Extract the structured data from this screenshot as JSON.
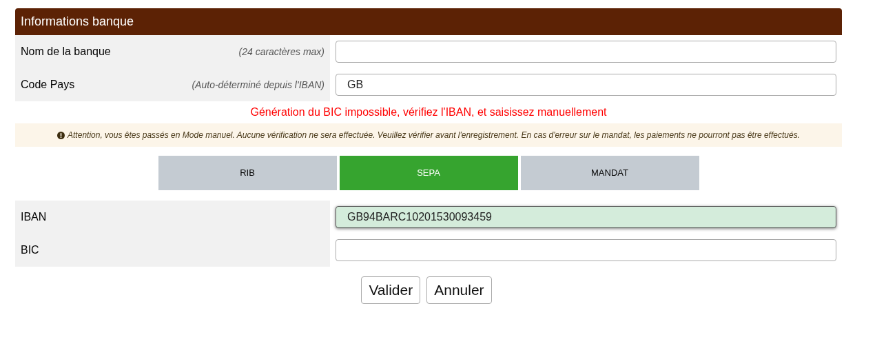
{
  "section": {
    "title": "Informations banque"
  },
  "bank_fields": [
    {
      "label": "Nom de la banque",
      "hint": "(24 caractères max)",
      "focused": false
    },
    {
      "label": "Code Pays",
      "hint": "(Auto-déterminé depuis l'IBAN)",
      "value": "GB",
      "focused": false
    }
  ],
  "error_message": "Génération du BIC impossible, vérifiez l'IBAN, et saisissez manuellement",
  "warning": "Attention, vous êtes passés en Mode manuel. Aucune vérification ne sera effectuée. Veuillez vérifier avant l'enregistrement. En cas d'erreur sur le mandat, les paiements ne pourront pas être effectués.",
  "tabs": [
    {
      "label": "RIB",
      "selected": false
    },
    {
      "label": "SEPA",
      "selected": true
    },
    {
      "label": "MANDAT",
      "selected": false
    }
  ],
  "sepa_fields": [
    {
      "label": "IBAN",
      "value": "GB94BARC10201530093459",
      "focused": true
    },
    {
      "label": "BIC",
      "focused": false
    }
  ],
  "buttons": [
    "Valider",
    "Annuler"
  ]
}
